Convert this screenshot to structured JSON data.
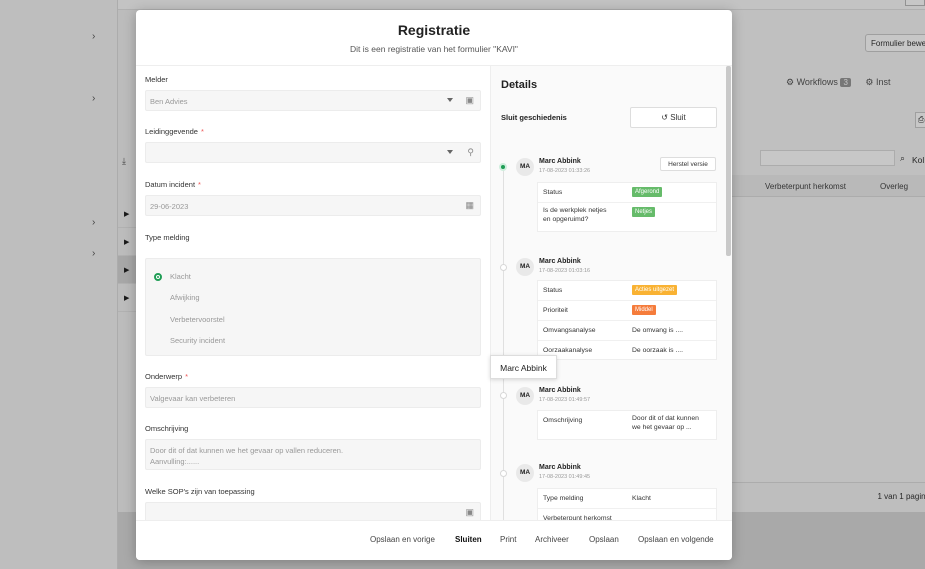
{
  "background": {
    "button_label": "Formulier bewe",
    "tabs": [
      {
        "label": "Workflows",
        "badge": "3"
      },
      {
        "label": "Inst"
      }
    ],
    "table_headers": [
      "Verbeterpunt herkomst",
      "Overleg"
    ],
    "column_partial": "Kol",
    "pagination": "1 van 1 pagina"
  },
  "modal": {
    "title": "Registratie",
    "subtitle": "Dit is een registratie van het formulier \"KAVI\"",
    "form": {
      "melder": {
        "label": "Melder",
        "value": "Ben Advies"
      },
      "leidinggevende": {
        "label": "Leidinggevende",
        "required": "*",
        "value": ""
      },
      "datum": {
        "label": "Datum incident",
        "required": "*",
        "value": "29-06-2023"
      },
      "type_melding": {
        "label": "Type melding",
        "options": [
          "Klacht",
          "Afwijking",
          "Verbetervoorstel",
          "Security incident"
        ],
        "selected": "Klacht"
      },
      "onderwerp": {
        "label": "Onderwerp",
        "required": "*",
        "value": "Valgevaar kan verbeteren"
      },
      "omschrijving": {
        "label": "Omschrijving",
        "line1": "Door dit of dat kunnen we het gevaar op vallen reduceren.",
        "line2": "Aanvulling:......"
      },
      "sop": {
        "label": "Welke SOP's zijn van toepassing",
        "value": ""
      }
    },
    "details": {
      "title": "Details",
      "history_label": "Sluit geschiedenis",
      "close_label": "Sluit",
      "restore_label": "Herstel versie",
      "entries": [
        {
          "initials": "MA",
          "name": "Marc Abbink",
          "date": "17-08-2023 01:33:26",
          "rows": [
            {
              "key": "Status",
              "pill": "Afgerond",
              "pill_color": "#66bb6a"
            },
            {
              "key": "Is de werkplek netjes",
              "key2": "en opgeruimd?",
              "pill": "Netjes",
              "pill_color": "#66bb6a"
            }
          ]
        },
        {
          "initials": "MA",
          "name": "Marc Abbink",
          "date": "17-08-2023 01:03:16",
          "rows": [
            {
              "key": "Status",
              "pill": "Acties uitgezet",
              "pill_color": "#f9b233"
            },
            {
              "key": "Prioriteit",
              "pill": "Middel",
              "pill_color": "#f57c3b"
            },
            {
              "key": "Omvangsanalyse",
              "value": "De omvang is ...."
            },
            {
              "key": "Oorzaakanalyse",
              "value": "De oorzaak is ...."
            }
          ]
        },
        {
          "initials": "MA",
          "name": "Marc Abbink",
          "date": "17-08-2023 01:49:57",
          "rows": [
            {
              "key": "Omschrijving",
              "value": "Door dit of dat kunnen",
              "value2": "we het gevaar op ..."
            }
          ]
        },
        {
          "initials": "MA",
          "name": "Marc Abbink",
          "date": "17-08-2023 01:49:45",
          "rows": [
            {
              "key": "Type melding",
              "value": "Klacht"
            },
            {
              "key": "Verbeterpunt herkomst",
              "value": ""
            }
          ]
        }
      ],
      "tooltip": "Marc Abbink"
    },
    "footer": {
      "save_prev": "Opslaan en vorige",
      "close": "Sluiten",
      "print": "Print",
      "archive": "Archiveer",
      "save": "Opslaan",
      "save_next": "Opslaan en volgende"
    }
  }
}
